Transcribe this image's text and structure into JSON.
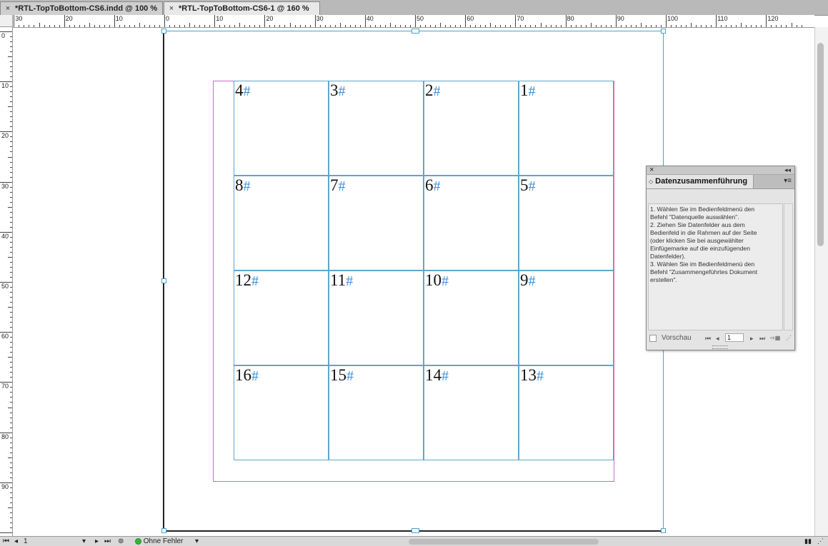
{
  "tabs": [
    {
      "close": "×",
      "label": "*RTL-TopToBottom-CS6.indd @ 100 %"
    },
    {
      "close": "×",
      "label": "*RTL-TopToBottom-CS6-1 @ 160 %"
    }
  ],
  "rulers": {
    "horizontal": [
      "30",
      "20",
      "10",
      "0",
      "10",
      "20",
      "30",
      "40",
      "50",
      "60",
      "70",
      "80",
      "90",
      "100",
      "110",
      "120"
    ],
    "vertical": [
      "0",
      "10",
      "20",
      "30",
      "40",
      "50",
      "60",
      "70",
      "80",
      "90"
    ]
  },
  "grid": {
    "rows": [
      [
        "4",
        "3",
        "2",
        "1"
      ],
      [
        "8",
        "7",
        "6",
        "5"
      ],
      [
        "12",
        "11",
        "10",
        "9"
      ],
      [
        "16",
        "15",
        "14",
        "13"
      ]
    ],
    "marker": "#"
  },
  "panel": {
    "close": "×",
    "collapse": "◂◂",
    "tab_arrows": "◇",
    "title": "Datenzusammenführung",
    "menu": "▾≡",
    "instructions": [
      "1. Wählen Sie im Bedienfeldmenü den",
      "Befehl \"Datenquelle auswählen\".",
      "2. Ziehen Sie Datenfelder aus dem",
      "Bedienfeld in die Rahmen auf der Seite",
      "(oder klicken Sie bei ausgewählter",
      "Einfügemarke auf die einzufügenden",
      "Datenfelder).",
      "3. Wählen Sie im Bedienfeldmenü den",
      "Befehl \"Zusammengeführtes Dokument",
      "erstellen\"."
    ],
    "preview_label": "Vorschau",
    "record_value": "1",
    "nav": {
      "first": "⏮",
      "prev": "◂",
      "next": "▸",
      "last": "⏭"
    }
  },
  "status": {
    "first": "⏮",
    "prev": "◂",
    "page": "1",
    "page_dropdown": "▾",
    "next": "▸",
    "last": "⏭",
    "preflight": "Ohne Fehler",
    "preflight_dropdown": "▾",
    "preflight_color": "#35b535"
  },
  "colors": {
    "frame": "#5fa7c9",
    "margin": "#c86bd0",
    "hash": "#3a8fd8"
  }
}
